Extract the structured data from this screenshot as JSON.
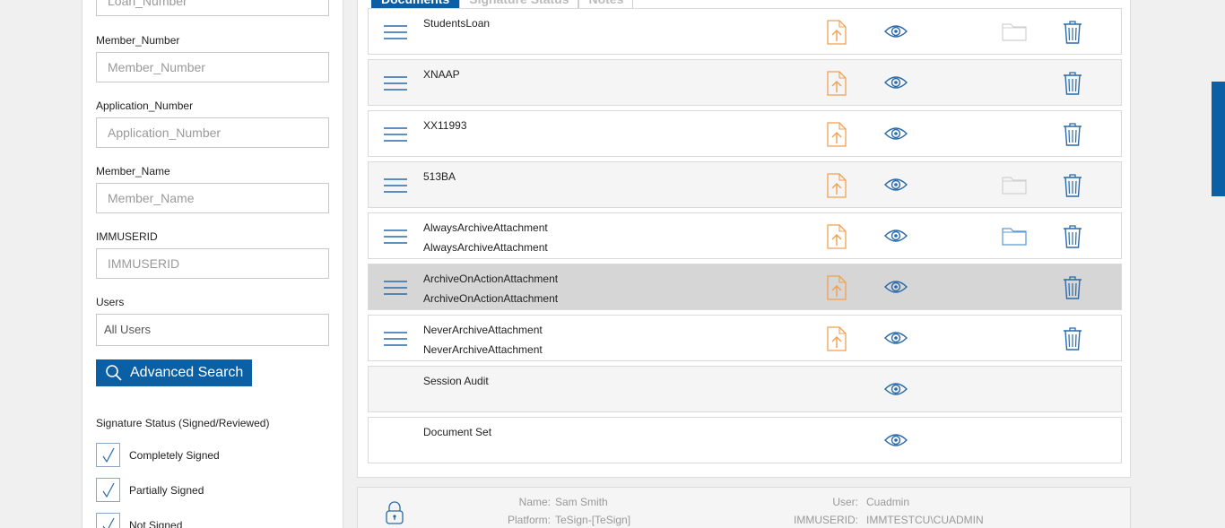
{
  "search": {
    "fields": [
      {
        "key": "loan_number",
        "label": "",
        "placeholder": "Loan_Number"
      },
      {
        "key": "member_number",
        "label": "Member_Number",
        "placeholder": "Member_Number"
      },
      {
        "key": "application_number",
        "label": "Application_Number",
        "placeholder": "Application_Number"
      },
      {
        "key": "member_name",
        "label": "Member_Name",
        "placeholder": "Member_Name"
      },
      {
        "key": "immuserid",
        "label": "IMMUSERID",
        "placeholder": "IMMUSERID"
      }
    ],
    "users_label": "Users",
    "users_value": "All Users",
    "advanced_search_label": "Advanced Search",
    "signature_status_label": "Signature Status (Signed/Reviewed)",
    "checkboxes": [
      {
        "label": "Completely Signed",
        "checked": true
      },
      {
        "label": "Partially Signed",
        "checked": true
      },
      {
        "label": "Not Signed",
        "checked": true
      }
    ]
  },
  "tabs": [
    "Documents",
    "Signature Status",
    "Notes"
  ],
  "documents": [
    {
      "name": "StudentsLoan",
      "sub": "",
      "upload": true,
      "view": true,
      "folder": "disabled",
      "delete": true
    },
    {
      "name": "XNAAP",
      "sub": "",
      "upload": true,
      "view": true,
      "folder": "none",
      "delete": true
    },
    {
      "name": "XX11993",
      "sub": "",
      "upload": true,
      "view": true,
      "folder": "none",
      "delete": true
    },
    {
      "name": "513BA",
      "sub": "",
      "upload": true,
      "view": true,
      "folder": "disabled",
      "delete": true
    },
    {
      "name": "AlwaysArchiveAttachment",
      "sub": "AlwaysArchiveAttachment",
      "upload": true,
      "view": true,
      "folder": "enabled",
      "delete": true
    },
    {
      "name": "ArchiveOnActionAttachment",
      "sub": "ArchiveOnActionAttachment",
      "upload": true,
      "view": true,
      "folder": "none",
      "delete": true
    },
    {
      "name": "NeverArchiveAttachment",
      "sub": "NeverArchiveAttachment",
      "upload": true,
      "view": true,
      "folder": "none",
      "delete": true
    },
    {
      "name": "Session Audit",
      "sub": "",
      "upload": false,
      "view": true,
      "folder": "none",
      "delete": false
    },
    {
      "name": "Document Set",
      "sub": "",
      "upload": false,
      "view": true,
      "folder": "none",
      "delete": false
    }
  ],
  "footer": {
    "name_key": "Name:",
    "name_value": "Sam Smith",
    "platform_key": "Platform:",
    "platform_value": "TeSign-[TeSign]",
    "user_key": "User:",
    "user_value": "Cuadmin",
    "immuserid_key": "IMMUSERID:",
    "immuserid_value": "IMMTESTCU\\CUADMIN"
  },
  "colors": {
    "accent": "#0b5fa5",
    "upload_icon": "#f0a050",
    "eye_icon": "#2a6aa8",
    "folder_enabled": "#5a9ad0",
    "folder_disabled": "#d0d0d0"
  }
}
